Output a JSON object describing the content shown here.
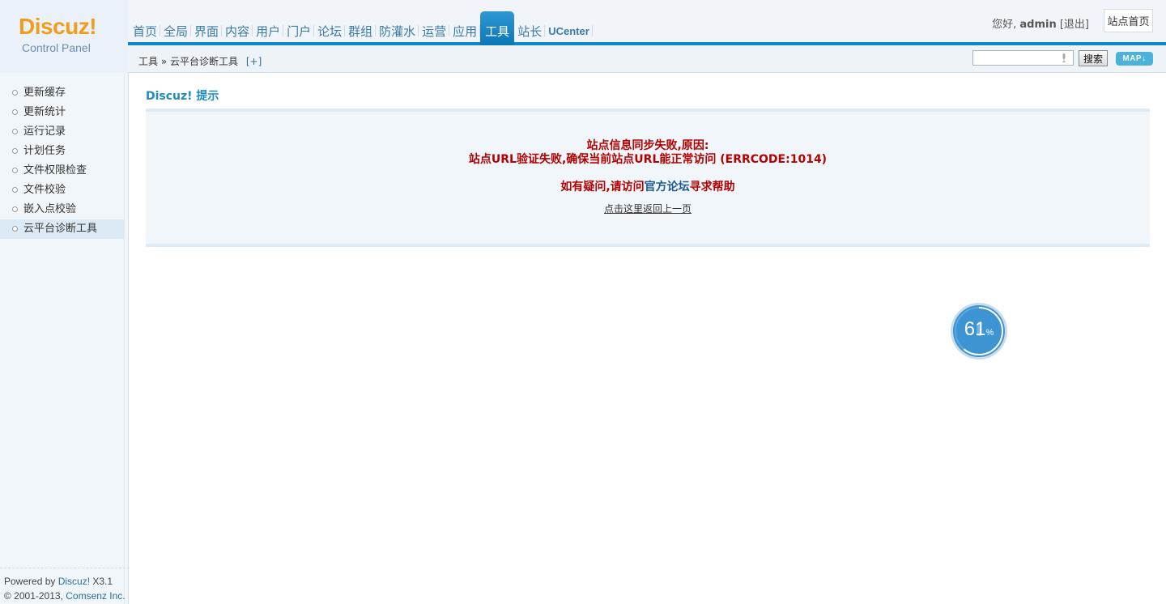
{
  "logo": {
    "brand": "Discuz!",
    "subtitle": "Control Panel"
  },
  "nav": {
    "items": [
      {
        "label": "首页"
      },
      {
        "label": "全局"
      },
      {
        "label": "界面"
      },
      {
        "label": "内容"
      },
      {
        "label": "用户"
      },
      {
        "label": "门户"
      },
      {
        "label": "论坛"
      },
      {
        "label": "群组"
      },
      {
        "label": "防灌水"
      },
      {
        "label": "运营"
      },
      {
        "label": "应用"
      },
      {
        "label": "工具",
        "active": true
      },
      {
        "label": "站长"
      },
      {
        "label": "UCenter"
      }
    ]
  },
  "user": {
    "greeting": "您好,",
    "name": "admin",
    "logout": "[退出]",
    "home_button": "站点首页"
  },
  "breadcrumb": {
    "section": "工具",
    "sep": "»",
    "page": "云平台诊断工具",
    "add": "[+]"
  },
  "search": {
    "placeholder": "",
    "button": "搜索",
    "map_button": "MAP"
  },
  "sidebar": {
    "items": [
      {
        "label": "更新缓存"
      },
      {
        "label": "更新统计"
      },
      {
        "label": "运行记录"
      },
      {
        "label": "计划任务"
      },
      {
        "label": "文件权限检查"
      },
      {
        "label": "文件校验"
      },
      {
        "label": "嵌入点校验"
      },
      {
        "label": "云平台诊断工具",
        "active": true
      }
    ],
    "footer": {
      "powered_prefix": "Powered by ",
      "powered_brand": "Discuz!",
      "version": " X3.1",
      "copyright_prefix": "© 2001-2013, ",
      "company": "Comsenz Inc."
    }
  },
  "main": {
    "title": "Discuz! 提示",
    "notice": {
      "line1": "站点信息同步失败,原因:",
      "line2": "站点URL验证失败,确保当前站点URL能正常访问 (ERRCODE:1014)",
      "line3_prefix": "如有疑问,请访问",
      "line3_link": "官方论坛",
      "line3_suffix": "寻求帮助",
      "back_link": "点击这里返回上一页"
    }
  },
  "progress_widget": {
    "value": 61,
    "unit": "%"
  },
  "colors": {
    "accent": "#0e86c9",
    "error": "#b30000",
    "link": "#1d5b8f",
    "logo": "#f29c1c"
  }
}
